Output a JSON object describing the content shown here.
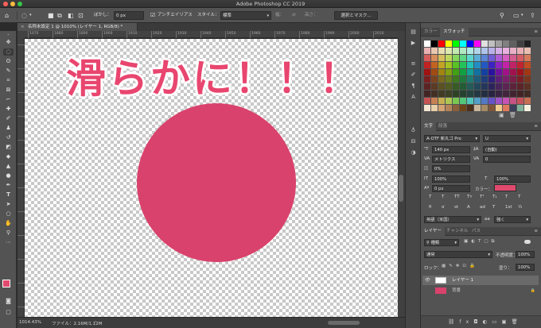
{
  "window": {
    "title": "Adobe Photoshop CC 2019"
  },
  "options_bar": {
    "feather_label": "ぼかし：",
    "feather_value": "0 px",
    "antialias_label": "アンチエイリアス",
    "style_label": "スタイル：",
    "style_value": "標準",
    "width_label": "幅：",
    "height_label": "高さ：",
    "select_mask_button": "選択とマスク..."
  },
  "document": {
    "tab_title": "名称未設定 1 @ 1010% (レイヤー 1, RGB/8) *",
    "headline": "滑らかに！！！",
    "circle_color": "#d9426c"
  },
  "ruler": {
    "ticks": [
      "1070",
      "1880",
      "1890",
      "1900",
      "1910",
      "1920",
      "1930",
      "1940",
      "1950",
      "1960",
      "1970",
      "1980",
      "1990",
      "2000",
      "2010",
      "2020"
    ]
  },
  "status": {
    "zoom": "1014.43%",
    "file_info": "ファイル：2.16M/1.12M"
  },
  "swatches_panel": {
    "tabs": [
      "カラー",
      "スウォッチ"
    ],
    "active_tab": "スウォッチ"
  },
  "character_panel": {
    "tabs": [
      "文字",
      "段落"
    ],
    "font_family": "A-OTF 新丸ゴ Pro",
    "font_style": "U",
    "font_size": "140 px",
    "leading": "(自動)",
    "kerning": "メトリクス",
    "tracking": "0",
    "tsume": "0%",
    "vertical_scale": "100%",
    "horizontal_scale": "100%",
    "baseline_shift": "0 px",
    "color_label": "カラー：",
    "color": "#e04a6e",
    "glyph_buttons": [
      "T",
      "T",
      "TT",
      "Tт",
      "T¹",
      "T₁",
      "T",
      "T"
    ],
    "ot_buttons": [
      "fi",
      "ơ",
      "st",
      "A",
      "ad",
      "T",
      "1st",
      "½"
    ],
    "language": "英語（米国）",
    "aa_label": "aa",
    "antialias": "強く"
  },
  "layers_panel": {
    "tabs": [
      "レイヤー",
      "チャンネル",
      "パス"
    ],
    "filter_kind": "種類",
    "blend_mode": "通常",
    "opacity_label": "不透明度：",
    "opacity": "100%",
    "lock_label": "ロック：",
    "fill_label": "塗り：",
    "fill": "100%",
    "layers": [
      {
        "name": "レイヤー 1",
        "selected": true
      },
      {
        "name": "背景",
        "selected": false
      }
    ]
  }
}
